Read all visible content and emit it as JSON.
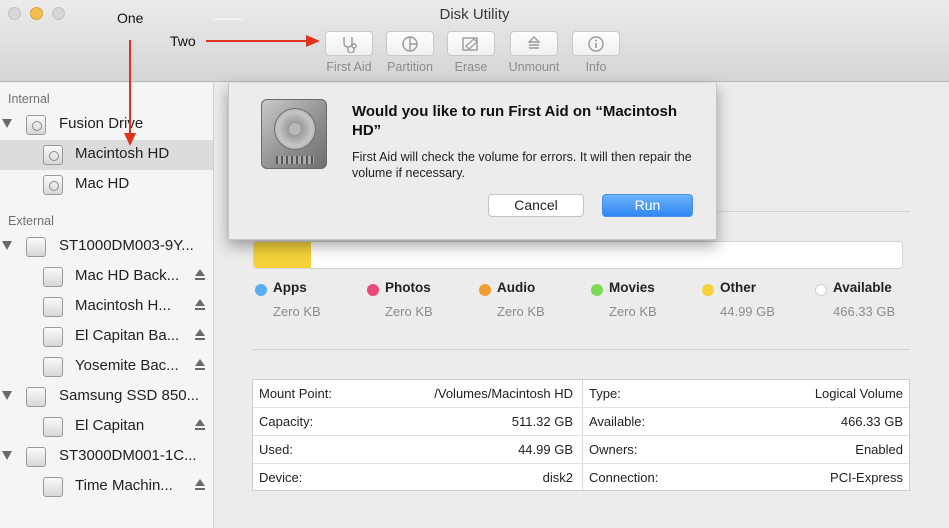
{
  "window": {
    "title": "Disk Utility"
  },
  "annotations": {
    "one": "One",
    "two": "Two"
  },
  "toolbar": {
    "items": [
      {
        "label": "First Aid",
        "icon": "stethoscope-icon"
      },
      {
        "label": "Partition",
        "icon": "partition-icon"
      },
      {
        "label": "Erase",
        "icon": "erase-icon"
      },
      {
        "label": "Unmount",
        "icon": "unmount-icon"
      },
      {
        "label": "Info",
        "icon": "info-icon"
      }
    ]
  },
  "sidebar": {
    "internal_header": "Internal",
    "external_header": "External",
    "items": [
      {
        "label": "Fusion Drive",
        "level": 0
      },
      {
        "label": "Macintosh HD",
        "level": 1,
        "selected": true
      },
      {
        "label": "Mac HD",
        "level": 1
      },
      {
        "label": "ST1000DM003-9Y...",
        "level": 0
      },
      {
        "label": "Mac HD Back...",
        "level": 1,
        "eject": true
      },
      {
        "label": "Macintosh H...",
        "level": 1,
        "eject": true
      },
      {
        "label": "El Capitan Ba...",
        "level": 1,
        "eject": true
      },
      {
        "label": "Yosemite Bac...",
        "level": 1,
        "eject": true
      },
      {
        "label": "Samsung SSD 850...",
        "level": 0
      },
      {
        "label": "El Capitan",
        "level": 1,
        "eject": true
      },
      {
        "label": "ST3000DM001-1C...",
        "level": 0
      },
      {
        "label": "Time Machin...",
        "level": 1,
        "eject": true
      }
    ]
  },
  "dialog": {
    "title": "Would you like to run First Aid on “Macintosh HD”",
    "body": "First Aid will check the volume for errors. It will then repair the volume if necessary.",
    "cancel_label": "Cancel",
    "run_label": "Run"
  },
  "usage": {
    "used_fraction": 0.088,
    "categories": [
      {
        "name": "Apps",
        "value": "Zero KB",
        "color": "#5aaef0"
      },
      {
        "name": "Photos",
        "value": "Zero KB",
        "color": "#e84a7a"
      },
      {
        "name": "Audio",
        "value": "Zero KB",
        "color": "#f0a030"
      },
      {
        "name": "Movies",
        "value": "Zero KB",
        "color": "#7ed957"
      },
      {
        "name": "Other",
        "value": "44.99 GB",
        "color": "#f5d23a"
      },
      {
        "name": "Available",
        "value": "466.33 GB",
        "color": "#ffffff"
      }
    ]
  },
  "info": {
    "left": [
      {
        "label": "Mount Point:",
        "value": "/Volumes/Macintosh HD"
      },
      {
        "label": "Capacity:",
        "value": "511.32 GB"
      },
      {
        "label": "Used:",
        "value": "44.99 GB"
      },
      {
        "label": "Device:",
        "value": "disk2"
      }
    ],
    "right": [
      {
        "label": "Type:",
        "value": "Logical Volume"
      },
      {
        "label": "Available:",
        "value": "466.33 GB"
      },
      {
        "label": "Owners:",
        "value": "Enabled"
      },
      {
        "label": "Connection:",
        "value": "PCI-Express"
      }
    ]
  },
  "colors": {
    "accent": "#2f86f3",
    "annotation_arrow": "#e0321c"
  }
}
